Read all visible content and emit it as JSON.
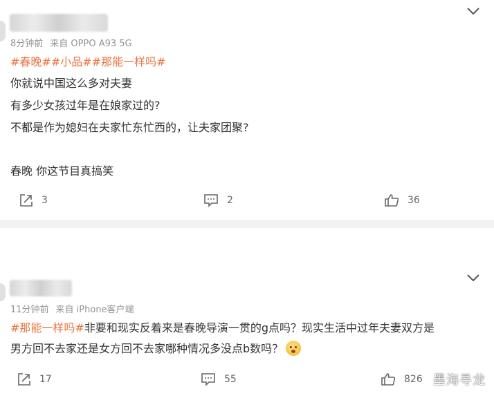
{
  "comments": [
    {
      "meta": {
        "time": "8分钟前",
        "source": "来自 OPPO A93 5G"
      },
      "topics": [
        "#春晚#",
        "#小品#",
        "#那能一样吗#"
      ],
      "lines": [
        "你就说中国这么多对夫妻",
        "有多少女孩过年是在娘家过的?",
        "不都是作为媳妇在夫家忙东忙西的，让夫家团聚?",
        "",
        "春晚 你这节目真搞笑"
      ],
      "actions": {
        "repost_count": "3",
        "comment_count": "2",
        "like_count": "36"
      }
    },
    {
      "meta": {
        "time": "11分钟前",
        "source": "来自 iPhone客户端"
      },
      "topic": "#那能一样吗#",
      "line1_rest": "非要和现实反着来是春晚导演一贯的g点吗？现实生活中过年夫妻双方是",
      "line2": "男方回不去家还是女方回不去家哪种情况多没点b数吗？",
      "actions": {
        "repost_count": "17",
        "comment_count": "55",
        "like_count": "826"
      }
    }
  ],
  "watermark": "墨海寻龙",
  "colors": {
    "topic": "#eb7340",
    "meta": "#939393",
    "separator": "#f2f2f4"
  },
  "icons": [
    "chevron-down-icon",
    "repost-icon",
    "comment-icon",
    "like-icon",
    "emoji-icon"
  ]
}
